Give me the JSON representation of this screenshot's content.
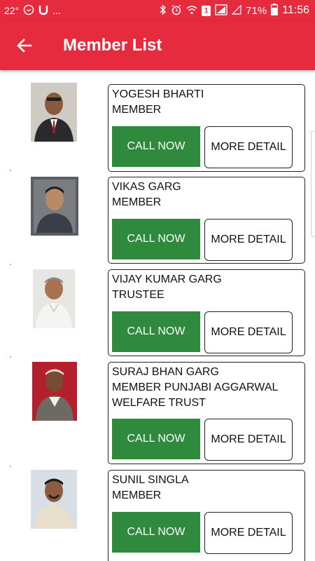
{
  "status_bar": {
    "temp": "22°",
    "left_dots": "...",
    "sim": "1",
    "battery": "71%",
    "time": "11:56"
  },
  "appbar": {
    "title": "Member List"
  },
  "members": [
    {
      "name": "YOGESH BHARTI",
      "role": "MEMBER",
      "call_label": "CALL NOW",
      "more_label": "MORE DETAIL"
    },
    {
      "name": "VIKAS GARG",
      "role": "MEMBER",
      "call_label": "CALL NOW",
      "more_label": "MORE DETAIL"
    },
    {
      "name": "VIJAY KUMAR GARG",
      "role": "TRUSTEE",
      "call_label": "CALL NOW",
      "more_label": "MORE DETAIL"
    },
    {
      "name": "SURAJ BHAN GARG",
      "role": "MEMBER PUNJABI AGGARWAL WELFARE TRUST",
      "call_label": "CALL NOW",
      "more_label": "MORE DETAIL"
    },
    {
      "name": "SUNIL SINGLA",
      "role": "MEMBER",
      "call_label": "CALL NOW",
      "more_label": "MORE DETAIL"
    }
  ],
  "colors": {
    "appbar": "#e62b3e",
    "call_button": "#2f8a3e"
  }
}
